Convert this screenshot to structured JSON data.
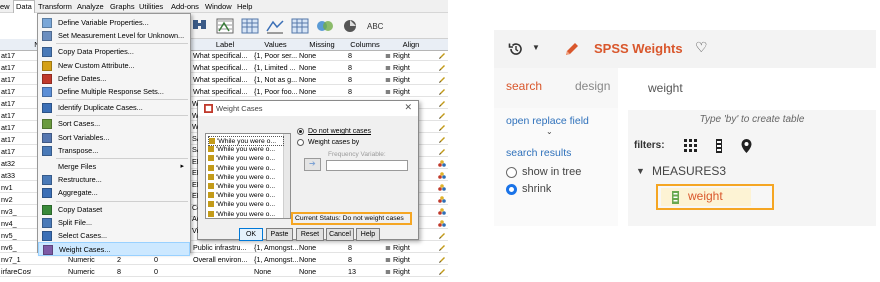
{
  "spss": {
    "menubar": [
      "ew",
      "Data",
      "Transform",
      "Analyze",
      "Graphs",
      "Utilities",
      "Add-ons",
      "Window",
      "Help"
    ],
    "grid_headers": [
      "N",
      "Label",
      "Values",
      "Missing",
      "Columns",
      "Align"
    ],
    "row_labels": [
      "at17",
      "at17",
      "at17",
      "at17",
      "at17",
      "at17",
      "at17",
      "at17",
      "at17",
      "at32",
      "at33",
      "nv1",
      "nv2",
      "nv3_",
      "nv4_",
      "nv5_",
      "nv6_",
      "nv7_1",
      "irfareCost"
    ],
    "rows": [
      {
        "label": "What specifical...",
        "values": "{1, Poor ser...",
        "missing": "None",
        "columns": "8",
        "align": "Right"
      },
      {
        "label": "What specifical...",
        "values": "{1, Limited ...",
        "missing": "None",
        "columns": "8",
        "align": "Right"
      },
      {
        "label": "What specifical...",
        "values": "{1, Not as g...",
        "missing": "None",
        "columns": "8",
        "align": "Right"
      },
      {
        "label": "What specifical...",
        "values": "{1, Poor foo...",
        "missing": "None",
        "columns": "8",
        "align": "Right"
      },
      {
        "label": "",
        "values": "",
        "missing": "",
        "columns": "",
        "align": ""
      },
      {
        "label": "",
        "values": "",
        "missing": "",
        "columns": "",
        "align": ""
      },
      {
        "label": "",
        "values": "",
        "missing": "",
        "columns": "",
        "align": ""
      },
      {
        "label": "",
        "values": "",
        "missing": "",
        "columns": "",
        "align": ""
      },
      {
        "label": "",
        "values": "",
        "missing": "",
        "columns": "",
        "align": ""
      },
      {
        "label": "",
        "values": "",
        "missing": "",
        "columns": "",
        "align": ""
      },
      {
        "label": "",
        "values": "",
        "missing": "",
        "columns": "",
        "align": ""
      },
      {
        "label": "",
        "values": "",
        "missing": "",
        "columns": "",
        "align": ""
      },
      {
        "label": "",
        "values": "",
        "missing": "",
        "columns": "",
        "align": ""
      },
      {
        "label": "",
        "values": "",
        "missing": "",
        "columns": "",
        "align": ""
      },
      {
        "label": "",
        "values": "",
        "missing": "",
        "columns": "",
        "align": ""
      },
      {
        "label": "",
        "values": "",
        "missing": "",
        "columns": "",
        "align": ""
      },
      {
        "label": "Public infrastru...",
        "values": "{1, Amongst...",
        "missing": "None",
        "columns": "8",
        "align": "Right"
      },
      {
        "label": "Overall environ...",
        "values": "{1, Amongst...",
        "missing": "None",
        "columns": "8",
        "align": "Right"
      },
      {
        "label": "",
        "values": "None",
        "missing": "None",
        "columns": "13",
        "align": "Right"
      }
    ],
    "bottom_rows": [
      {
        "type": "Numeric",
        "width": "2",
        "decimals": "0"
      },
      {
        "type": "Numeric",
        "width": "8",
        "decimals": "0"
      }
    ],
    "partial_labels": [
      "Wh",
      "Wh",
      "Wh",
      "SA",
      "SA",
      "EN",
      "EN",
      "EN",
      "EN",
      "Co",
      "Ac",
      "Vi"
    ],
    "data_menu": {
      "items": [
        "Define Variable Properties...",
        "Set Measurement Level for Unknown...",
        "Copy Data Properties...",
        "New Custom Attribute...",
        "Define Dates...",
        "Define Multiple Response Sets...",
        "Identify Duplicate Cases...",
        "Sort Cases...",
        "Sort Variables...",
        "Transpose...",
        "Merge Files",
        "Restructure...",
        "Aggregate...",
        "Copy Dataset",
        "Split File...",
        "Select Cases...",
        "Weight Cases..."
      ]
    },
    "weight_dialog": {
      "title": "Weight Cases",
      "variables": [
        "'While you were o...",
        "'While you were o...",
        "'While you were o...",
        "'While you were o...",
        "'While you were o...",
        "'While you were o...",
        "'While you were o...",
        "'While you were o...",
        "'While you were o..."
      ],
      "radio_off": "Do not weight cases",
      "radio_on": "Weight cases by",
      "freq_label": "Frequency Variable:",
      "status": "Current Status: Do not weight cases",
      "buttons": [
        "OK",
        "Paste",
        "Reset",
        "Cancel",
        "Help"
      ]
    },
    "colors": {
      "highlight": "#f5a623",
      "menu_hover": "#cce8ff"
    }
  },
  "rpanel": {
    "title": "SPSS Weights",
    "tabs": {
      "search": "search",
      "design": "design"
    },
    "search_value": "weight",
    "hint": "Type 'by' to create table",
    "open_replace": "open replace field",
    "search_results": "search results",
    "opt_show_in_tree": "show in tree",
    "opt_shrink": "shrink",
    "filters_label": "filters:",
    "tree_group": "MEASURES3",
    "tree_item": "weight",
    "colors": {
      "accent": "#d9572c",
      "link": "#2f71bb",
      "highlight": "#f5a623"
    }
  }
}
